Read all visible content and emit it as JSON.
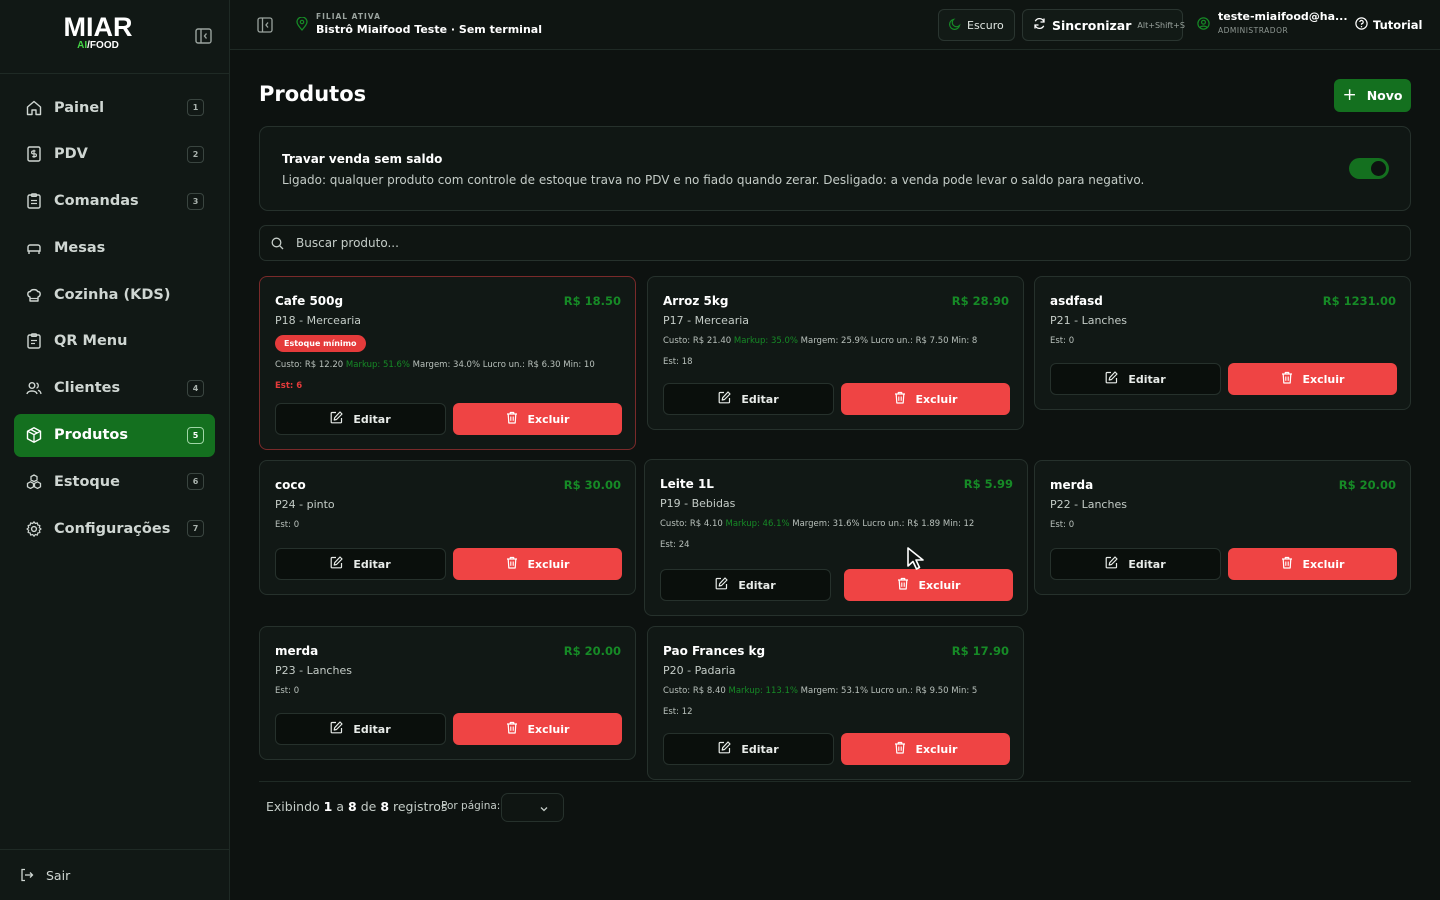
{
  "brand": {
    "logo_main": "MIAR",
    "logo_sub_ai": "AI",
    "logo_sub_rest": "/FOOD"
  },
  "sidebar": {
    "items": [
      {
        "label": "Painel",
        "shortcut": "1",
        "icon": "home-icon"
      },
      {
        "label": "PDV",
        "shortcut": "2",
        "icon": "pos-icon"
      },
      {
        "label": "Comandas",
        "shortcut": "3",
        "icon": "clipboard-icon"
      },
      {
        "label": "Mesas",
        "shortcut": "",
        "icon": "table-icon"
      },
      {
        "label": "Cozinha (KDS)",
        "shortcut": "",
        "icon": "chef-hat-icon"
      },
      {
        "label": "QR Menu",
        "shortcut": "",
        "icon": "qr-menu-icon"
      },
      {
        "label": "Clientes",
        "shortcut": "4",
        "icon": "users-icon"
      },
      {
        "label": "Produtos",
        "shortcut": "5",
        "icon": "package-icon",
        "active": true
      },
      {
        "label": "Estoque",
        "shortcut": "6",
        "icon": "boxes-icon"
      },
      {
        "label": "Configurações",
        "shortcut": "7",
        "icon": "gear-icon"
      }
    ],
    "logout_label": "Sair"
  },
  "topbar": {
    "branch_label": "FILIAL ATIVA",
    "branch_name": "Bistrô Miaifood Teste · Sem terminal",
    "theme_label": "Escuro",
    "sync_label": "Sincronizar",
    "sync_hint": "Alt+Shift+S",
    "user_email": "teste-miaifood@ha...",
    "user_role": "ADMINISTRADOR",
    "tutorial_label": "Tutorial"
  },
  "page": {
    "title": "Produtos",
    "new_label": "Novo",
    "lock_title": "Travar venda sem saldo",
    "lock_desc": "Ligado: qualquer produto com controle de estoque trava no PDV e no fiado quando zerar. Desligado: a venda pode levar o saldo para negativo.",
    "lock_enabled": true,
    "search_placeholder": "Buscar produto..."
  },
  "products": [
    {
      "name": "Cafe 500g",
      "price": "R$ 18.50",
      "cat": "P18 - Mercearia",
      "badge": "Estoque mínimo",
      "custo": "Custo: R$ 12.20",
      "markup": "Markup: 51.6%",
      "rest": "Margem: 34.0%   Lucro un.: R$ 6.30   Min: 10",
      "stock": "Est: 6"
    },
    {
      "name": "Arroz 5kg",
      "price": "R$ 28.90",
      "cat": "P17 - Mercearia",
      "custo": "Custo: R$ 21.40",
      "markup": "Markup: 35.0%",
      "rest": "Margem: 25.9%   Lucro un.: R$ 7.50   Min: 8",
      "stock": "Est: 18"
    },
    {
      "name": "asdfasd",
      "price": "R$ 1231.00",
      "cat": "P21 - Lanches",
      "stock": "Est: 0"
    },
    {
      "name": "coco",
      "price": "R$ 30.00",
      "cat": "P24 - pinto",
      "stock": "Est: 0"
    },
    {
      "name": "Leite 1L",
      "price": "R$ 5.99",
      "cat": "P19 - Bebidas",
      "custo": "Custo: R$ 4.10",
      "markup": "Markup: 46.1%",
      "rest": "Margem: 31.6%   Lucro un.: R$ 1.89   Min: 12",
      "stock": "Est: 24"
    },
    {
      "name": "merda",
      "price": "R$ 20.00",
      "cat": "P22 - Lanches",
      "stock": "Est: 0"
    },
    {
      "name": "merda",
      "price": "R$ 20.00",
      "cat": "P23 - Lanches",
      "stock": "Est: 0"
    },
    {
      "name": "Pao Frances kg",
      "price": "R$ 17.90",
      "cat": "P20 - Padaria",
      "custo": "Custo: R$ 8.40",
      "markup": "Markup: 113.1%",
      "rest": "Margem: 53.1%   Lucro un.: R$ 9.50   Min: 5",
      "stock": "Est: 12"
    }
  ],
  "actions": {
    "edit_label": "Editar",
    "delete_label": "Excluir"
  },
  "pager": {
    "prefix": "Exibindo",
    "from": "1",
    "sep1": "a",
    "to": "8",
    "sep2": "de",
    "total": "8",
    "suffix": "registros",
    "per_page_label": "Por página:"
  },
  "colors": {
    "accent": "#14701f",
    "price": "#168a26",
    "danger": "#ef4444",
    "background": "#0d1210"
  }
}
